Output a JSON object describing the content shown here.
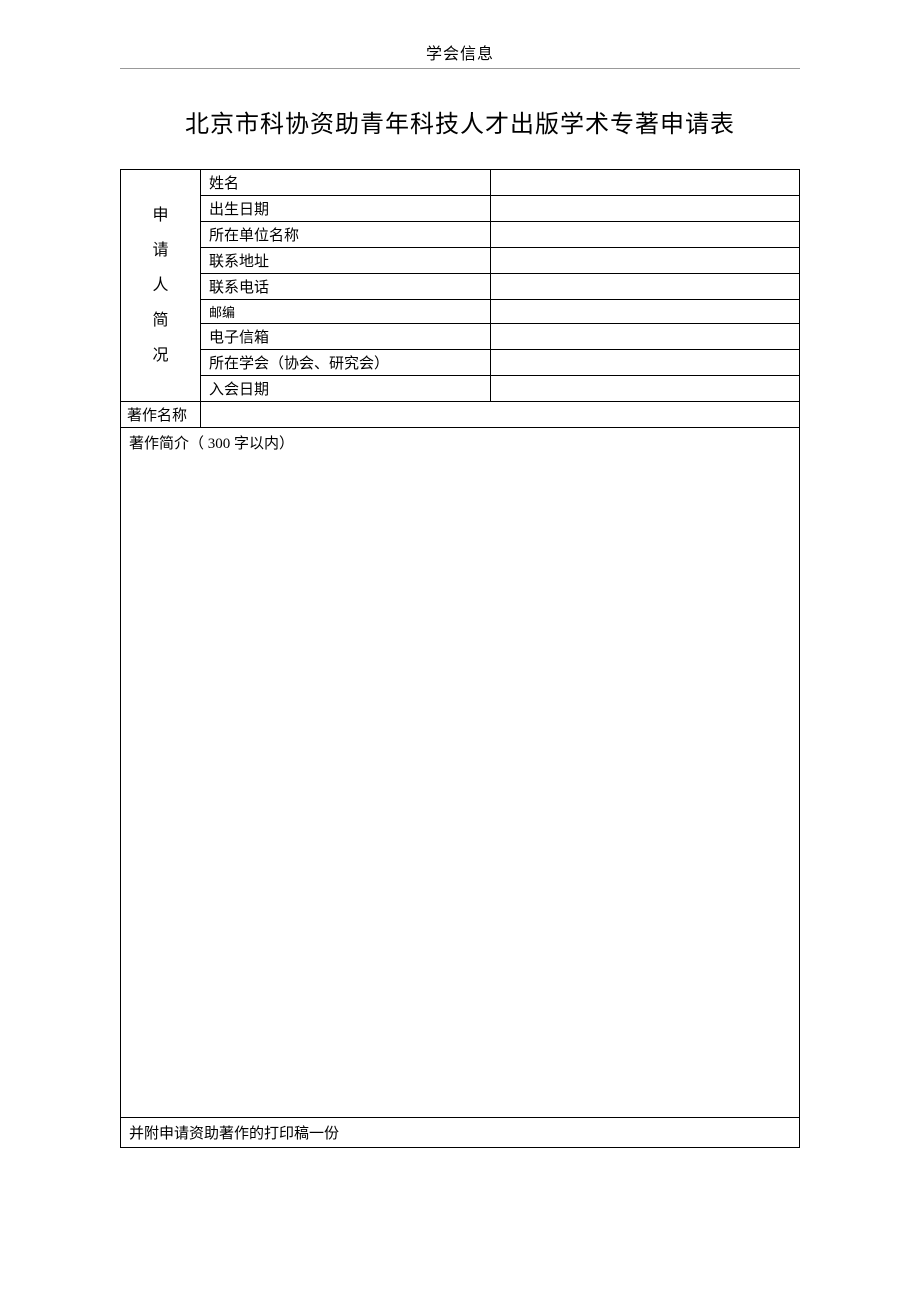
{
  "header": "学会信息",
  "title": "北京市科协资助青年科技人才出版学术专著申请表",
  "applicant_section_label": {
    "c1": "申",
    "c2": "请",
    "c3": "人",
    "c4": "简",
    "c5": "况"
  },
  "rows": {
    "name": {
      "label": "姓名",
      "value": ""
    },
    "birth_date": {
      "label": "出生日期",
      "value": ""
    },
    "org": {
      "label": "所在单位名称",
      "value": ""
    },
    "address": {
      "label": "联系地址",
      "value": ""
    },
    "phone": {
      "label": "联系电话",
      "value": ""
    },
    "postcode": {
      "label": "邮编",
      "value": ""
    },
    "email": {
      "label": "电子信箱",
      "value": ""
    },
    "society": {
      "label": "所在学会（协会、研究会）",
      "value": ""
    },
    "join_date": {
      "label": "入会日期",
      "value": ""
    }
  },
  "book_name": {
    "label": "著作名称",
    "value": ""
  },
  "summary": {
    "label": "著作简介（ 300 字以内）",
    "value": ""
  },
  "footer_note": "并附申请资助著作的打印稿一份"
}
